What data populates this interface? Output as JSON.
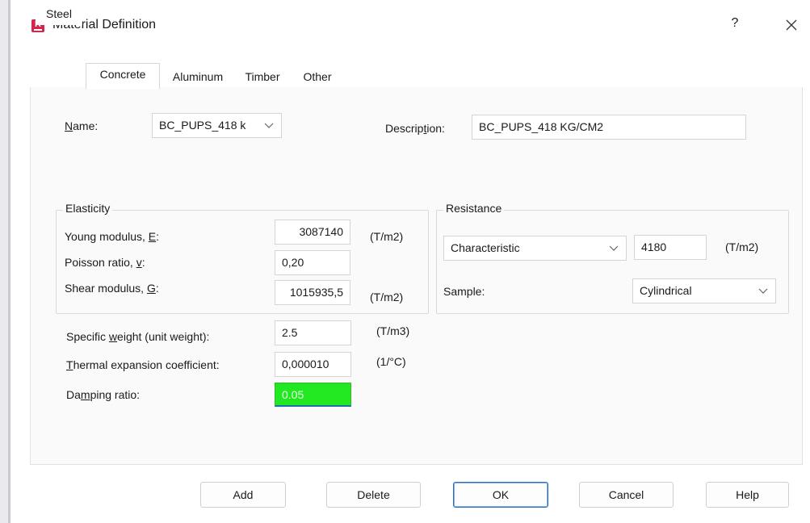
{
  "window": {
    "title": "Material Definition",
    "help_label": "?",
    "close_label": "✕",
    "app_icon_letter": "R"
  },
  "tabs": [
    {
      "label": "Steel",
      "active": false
    },
    {
      "label": "Concrete",
      "active": true
    },
    {
      "label": "Aluminum",
      "active": false
    },
    {
      "label": "Timber",
      "active": false
    },
    {
      "label": "Other",
      "active": false
    }
  ],
  "header": {
    "name_label_pre": "",
    "name_label_u": "N",
    "name_label_post": "ame:",
    "name_value": "BC_PUPS_418 k",
    "description_label_pre": "Descrip",
    "description_label_u": "t",
    "description_label_post": "ion:",
    "description_value": "BC_PUPS_418 KG/CM2"
  },
  "elasticity": {
    "title": "Elasticity",
    "young": {
      "label_pre": "Young modulus, ",
      "label_u": "E",
      "label_post": ":",
      "value": "3087140",
      "unit": "(T/m2)"
    },
    "poisson": {
      "label_pre": "Poisson ratio, ",
      "label_u": "v",
      "label_post": ":",
      "value": "0,20"
    },
    "shear": {
      "label_pre": "Shear modulus, ",
      "label_u": "G",
      "label_post": ":",
      "value": "1015935,5",
      "unit": "(T/m2)"
    }
  },
  "resistance": {
    "title": "Resistance",
    "type_selected": "Characteristic",
    "value": "4180",
    "unit": "(T/m2)",
    "sample_label": "Sample:",
    "sample_selected": "Cylindrical"
  },
  "properties": {
    "specific_weight": {
      "label_pre": "Specific ",
      "label_u": "w",
      "label_post": "eight (unit weight):",
      "value": "2.5",
      "unit": "(T/m3)"
    },
    "thermal": {
      "label_pre": "",
      "label_u": "T",
      "label_post": "hermal expansion coefficient:",
      "value": "0,000010",
      "unit": "(1/°C)"
    },
    "damping": {
      "label_pre": "Da",
      "label_u": "m",
      "label_post": "ping ratio:",
      "value": "0.05"
    }
  },
  "buttons": {
    "add": "Add",
    "delete": "Delete",
    "ok": "OK",
    "cancel": "Cancel",
    "help": "Help"
  },
  "colors": {
    "damping_highlight": "#22e822",
    "default_button_border": "#2b6cc4",
    "app_icon": "#d3264b"
  }
}
